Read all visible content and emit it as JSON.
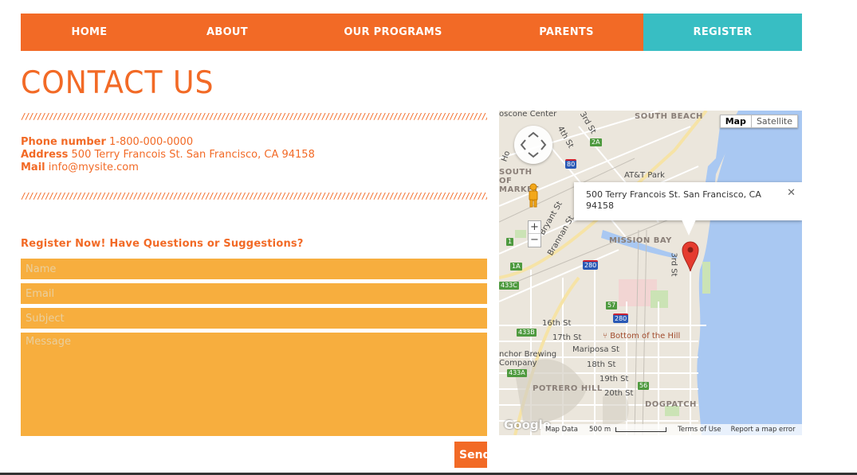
{
  "nav": {
    "home": "HOME",
    "about": "ABOUT",
    "programs": "OUR PROGRAMS",
    "parents": "PARENTS",
    "register": "REGISTER"
  },
  "page": {
    "title": "CONTACT US",
    "divider": "/////////////////////////////////////////////////////////////////////////////////////////////////////////////////////////////////////////////////"
  },
  "contact": {
    "phone_label": "Phone number",
    "phone_value": "1-800-000-0000",
    "address_label": "Address",
    "address_value": "500 Terry Francois St. San Francisco, CA 94158",
    "mail_label": "Mail",
    "mail_value": "info@mysite.com"
  },
  "form": {
    "heading": "Register Now! Have Questions or Suggestions?",
    "name_placeholder": "Name",
    "email_placeholder": "Email",
    "subject_placeholder": "Subject",
    "message_placeholder": "Message",
    "send_label": "Send"
  },
  "map": {
    "type_map": "Map",
    "type_satellite": "Satellite",
    "info_text": "500 Terry Francois St. San Francisco, CA 94158",
    "close_glyph": "✕",
    "zoom_in": "+",
    "zoom_out": "−",
    "logo": "Google",
    "footer": {
      "data": "Map Data",
      "scale": "500 m",
      "terms": "Terms of Use",
      "report": "Report a map error"
    },
    "labels": {
      "moscone": "oscone Center",
      "south_beach": "SOUTH BEACH",
      "att_park": "AT&T Park",
      "south_of_market": "SOUTH OF MARKET",
      "mission_bay": "MISSION BAY",
      "third_st_a": "3rd St",
      "third_st_b": "3rd St",
      "fourth_st": "4th St",
      "brannan": "Brannan St",
      "bryant": "Bryant St",
      "ho": "Ho",
      "sixteenth": "16th St",
      "seventeenth": "17th St",
      "bottom_hill": "Bottom of the Hill",
      "mariposa": "Mariposa St",
      "anchor": "nchor Brewing Company",
      "eighteenth": "18th St",
      "nineteenth": "19th St",
      "twentieth": "20th St",
      "potrero_hill": "POTRERO HILL",
      "dogpatch": "DOGPATCH"
    },
    "shields": {
      "i80": "80",
      "i280_a": "280",
      "i280_b": "280",
      "h2a": "2A",
      "h1a": "1A",
      "h1": "1",
      "h433c": "433C",
      "h433b": "433B",
      "h433a": "433A",
      "h57": "57",
      "h56": "56"
    }
  }
}
